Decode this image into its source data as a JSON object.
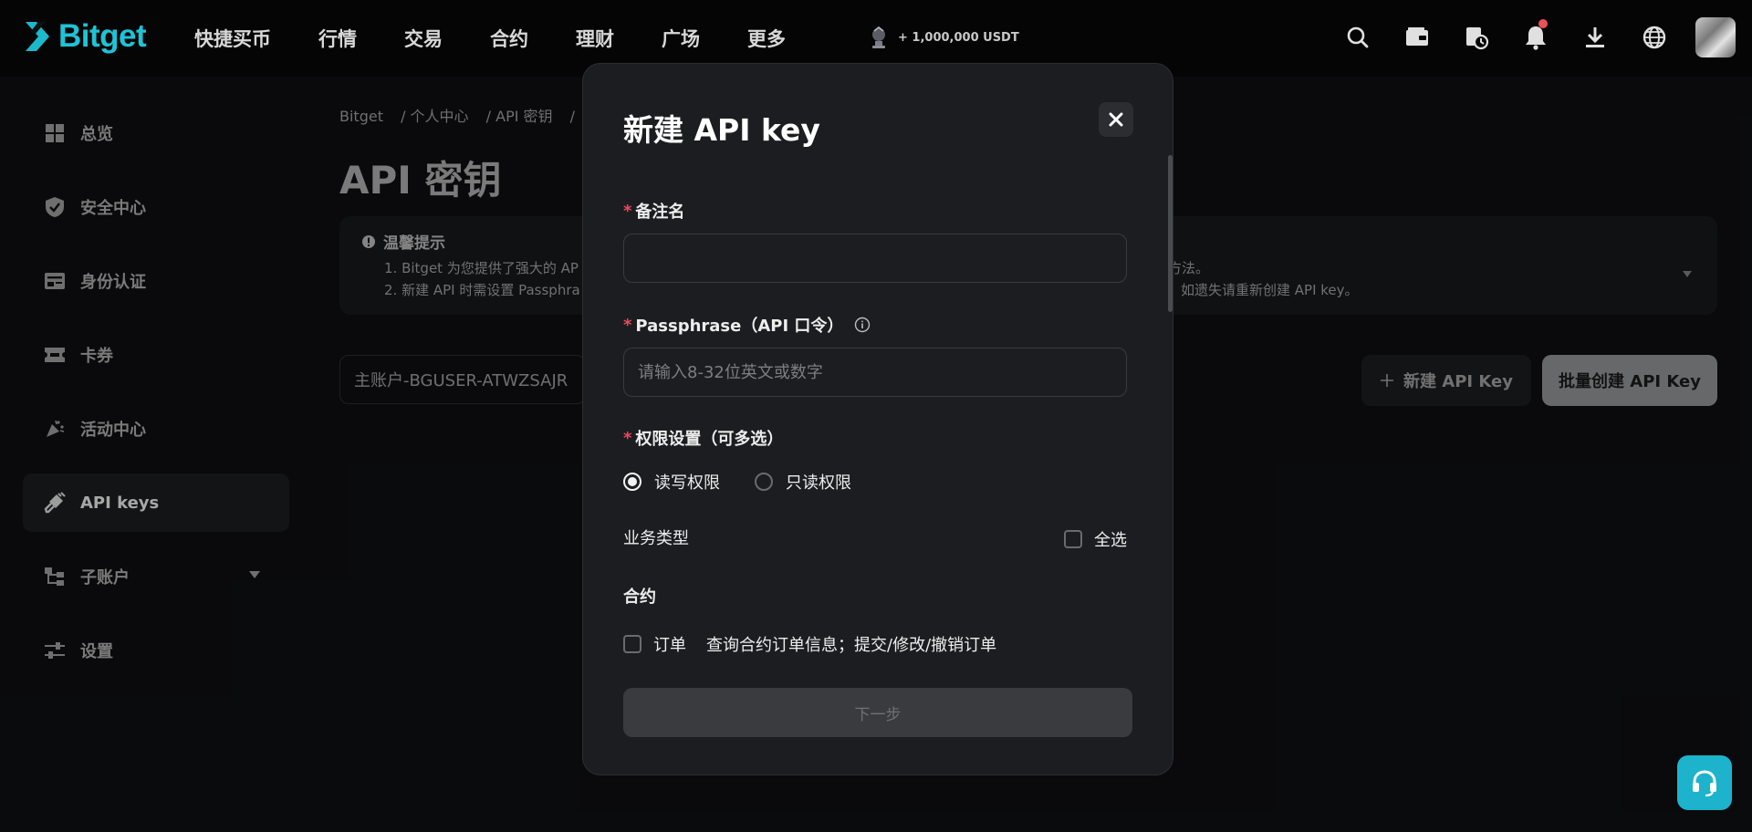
{
  "brand": {
    "name": "Bitget",
    "accent": "#1ec3d6"
  },
  "nav": {
    "items": [
      "快捷买币",
      "行情",
      "交易",
      "合约",
      "理财",
      "广场",
      "更多"
    ],
    "promo": "+ 1,000,000 USDT",
    "icons": [
      "search-icon",
      "wallet-icon",
      "order-history-icon",
      "bell-icon",
      "download-icon",
      "globe-icon",
      "avatar"
    ]
  },
  "sidebar": {
    "items": [
      {
        "label": "总览",
        "icon": "overview-grid-icon"
      },
      {
        "label": "安全中心",
        "icon": "shield-check-icon"
      },
      {
        "label": "身份认证",
        "icon": "id-card-icon"
      },
      {
        "label": "卡券",
        "icon": "ticket-icon"
      },
      {
        "label": "活动中心",
        "icon": "party-popper-icon"
      },
      {
        "label": "API keys",
        "icon": "plug-icon",
        "active": true
      },
      {
        "label": "子账户",
        "icon": "sub-account-tree-icon"
      },
      {
        "label": "设置",
        "icon": "sliders-icon"
      }
    ]
  },
  "breadcrumb": [
    "Bitget",
    "/  个人中心",
    "/  API 密钥",
    "/"
  ],
  "page": {
    "title": "API 密钥",
    "notice": {
      "title": "温馨提示",
      "line1": "1. Bitget 为您提供了强大的 AP",
      "line1_tail": "方法。",
      "line2": "2. 新建 API 时需设置 Passphra",
      "line2_tail": "如遗失请重新创建 API key。"
    },
    "account_select": "主账户-BGUSER-ATWZSAJR",
    "btn_new": "新建 API Key",
    "btn_batch": "批量创建 API Key"
  },
  "modal": {
    "title": "新建 API key",
    "remark": {
      "label": "备注名",
      "value": "",
      "placeholder": ""
    },
    "passphrase": {
      "label": "Passphrase（API 口令）",
      "value": "",
      "placeholder": "请输入8-32位英文或数字"
    },
    "permission": {
      "label": "权限设置（可多选）",
      "options": [
        "读写权限",
        "只读权限"
      ],
      "selected": "读写权限"
    },
    "business_type": "业务类型",
    "select_all": "全选",
    "section_contract": "合约",
    "order_label": "订单",
    "order_desc": "查询合约订单信息；提交/修改/撤销订单",
    "next_button": "下一步"
  },
  "support_icon": "headset-icon"
}
